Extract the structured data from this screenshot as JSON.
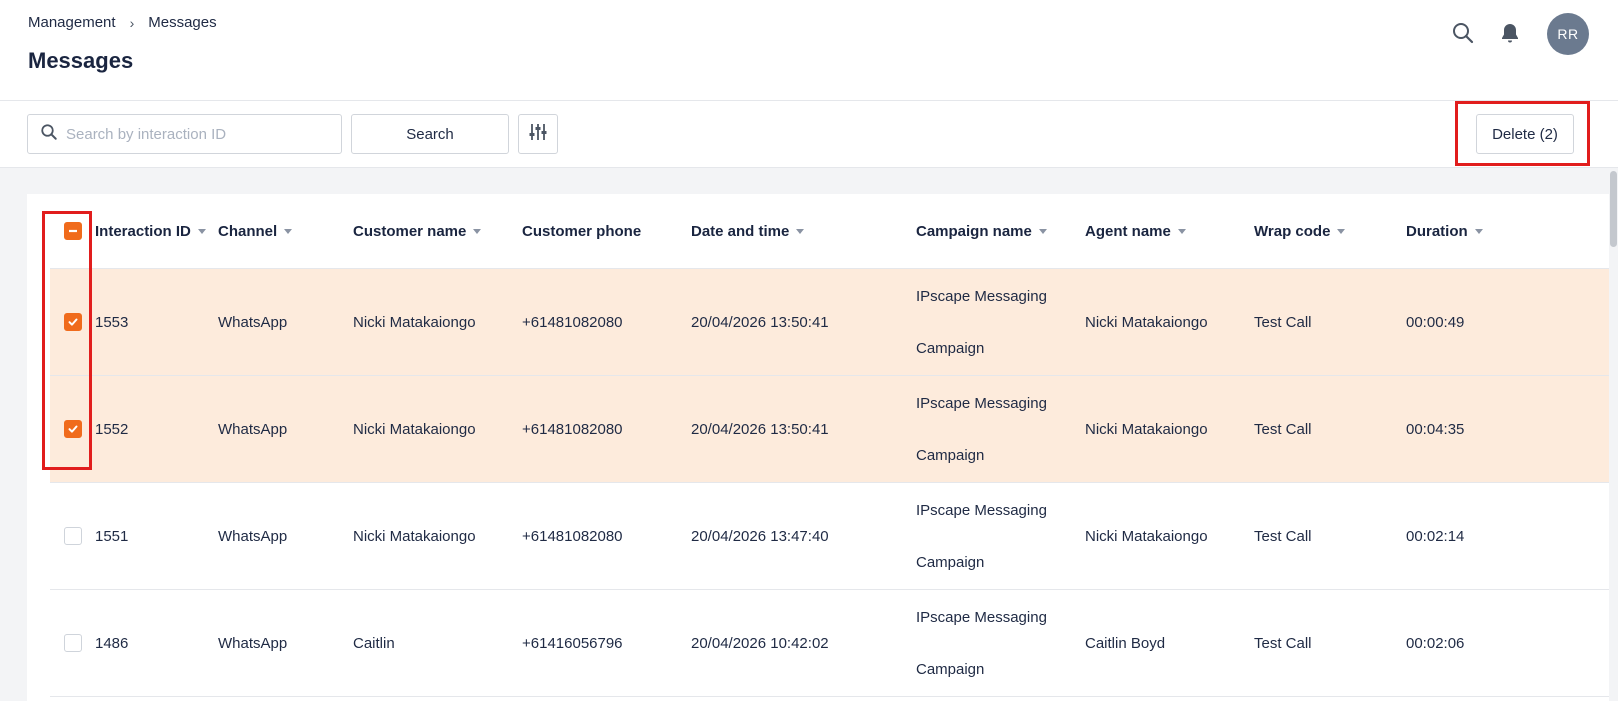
{
  "breadcrumb": {
    "parent": "Management",
    "current": "Messages"
  },
  "page_title": "Messages",
  "header": {
    "avatar_initials": "RR",
    "search_icon": "search-icon",
    "bell_icon": "bell-icon"
  },
  "toolbar": {
    "search_placeholder": "Search by interaction ID",
    "search_value": "",
    "search_button": "Search",
    "filter_icon": "sliders-icon",
    "delete_button": "Delete (2)"
  },
  "colors": {
    "accent": "#f06b1c",
    "selected_row": "#fdebdc",
    "highlight_box": "#e11d1d"
  },
  "table": {
    "columns": [
      "Interaction ID",
      "Channel",
      "Customer name",
      "Customer phone",
      "Date and time",
      "Campaign name",
      "Agent name",
      "Wrap code",
      "Duration"
    ],
    "header_checkbox": "indeterminate",
    "rows": [
      {
        "selected": true,
        "id": "1553",
        "channel": "WhatsApp",
        "customer_name": "Nicki Matakaiongo",
        "customer_phone": "+61481082080",
        "datetime": "20/04/2026 13:50:41",
        "campaign_line1": "IPscape Messaging",
        "campaign_line2": "Campaign",
        "agent": "Nicki Matakaiongo",
        "wrap_code": "Test Call",
        "duration": "00:00:49"
      },
      {
        "selected": true,
        "id": "1552",
        "channel": "WhatsApp",
        "customer_name": "Nicki Matakaiongo",
        "customer_phone": "+61481082080",
        "datetime": "20/04/2026 13:50:41",
        "campaign_line1": "IPscape Messaging",
        "campaign_line2": "Campaign",
        "agent": "Nicki Matakaiongo",
        "wrap_code": "Test Call",
        "duration": "00:04:35"
      },
      {
        "selected": false,
        "id": "1551",
        "channel": "WhatsApp",
        "customer_name": "Nicki Matakaiongo",
        "customer_phone": "+61481082080",
        "datetime": "20/04/2026 13:47:40",
        "campaign_line1": "IPscape Messaging",
        "campaign_line2": "Campaign",
        "agent": "Nicki Matakaiongo",
        "wrap_code": "Test Call",
        "duration": "00:02:14"
      },
      {
        "selected": false,
        "id": "1486",
        "channel": "WhatsApp",
        "customer_name": "Caitlin",
        "customer_phone": "+61416056796",
        "datetime": "20/04/2026 10:42:02",
        "campaign_line1": "IPscape Messaging",
        "campaign_line2": "Campaign",
        "agent": "Caitlin Boyd",
        "wrap_code": "Test Call",
        "duration": "00:02:06"
      }
    ]
  }
}
